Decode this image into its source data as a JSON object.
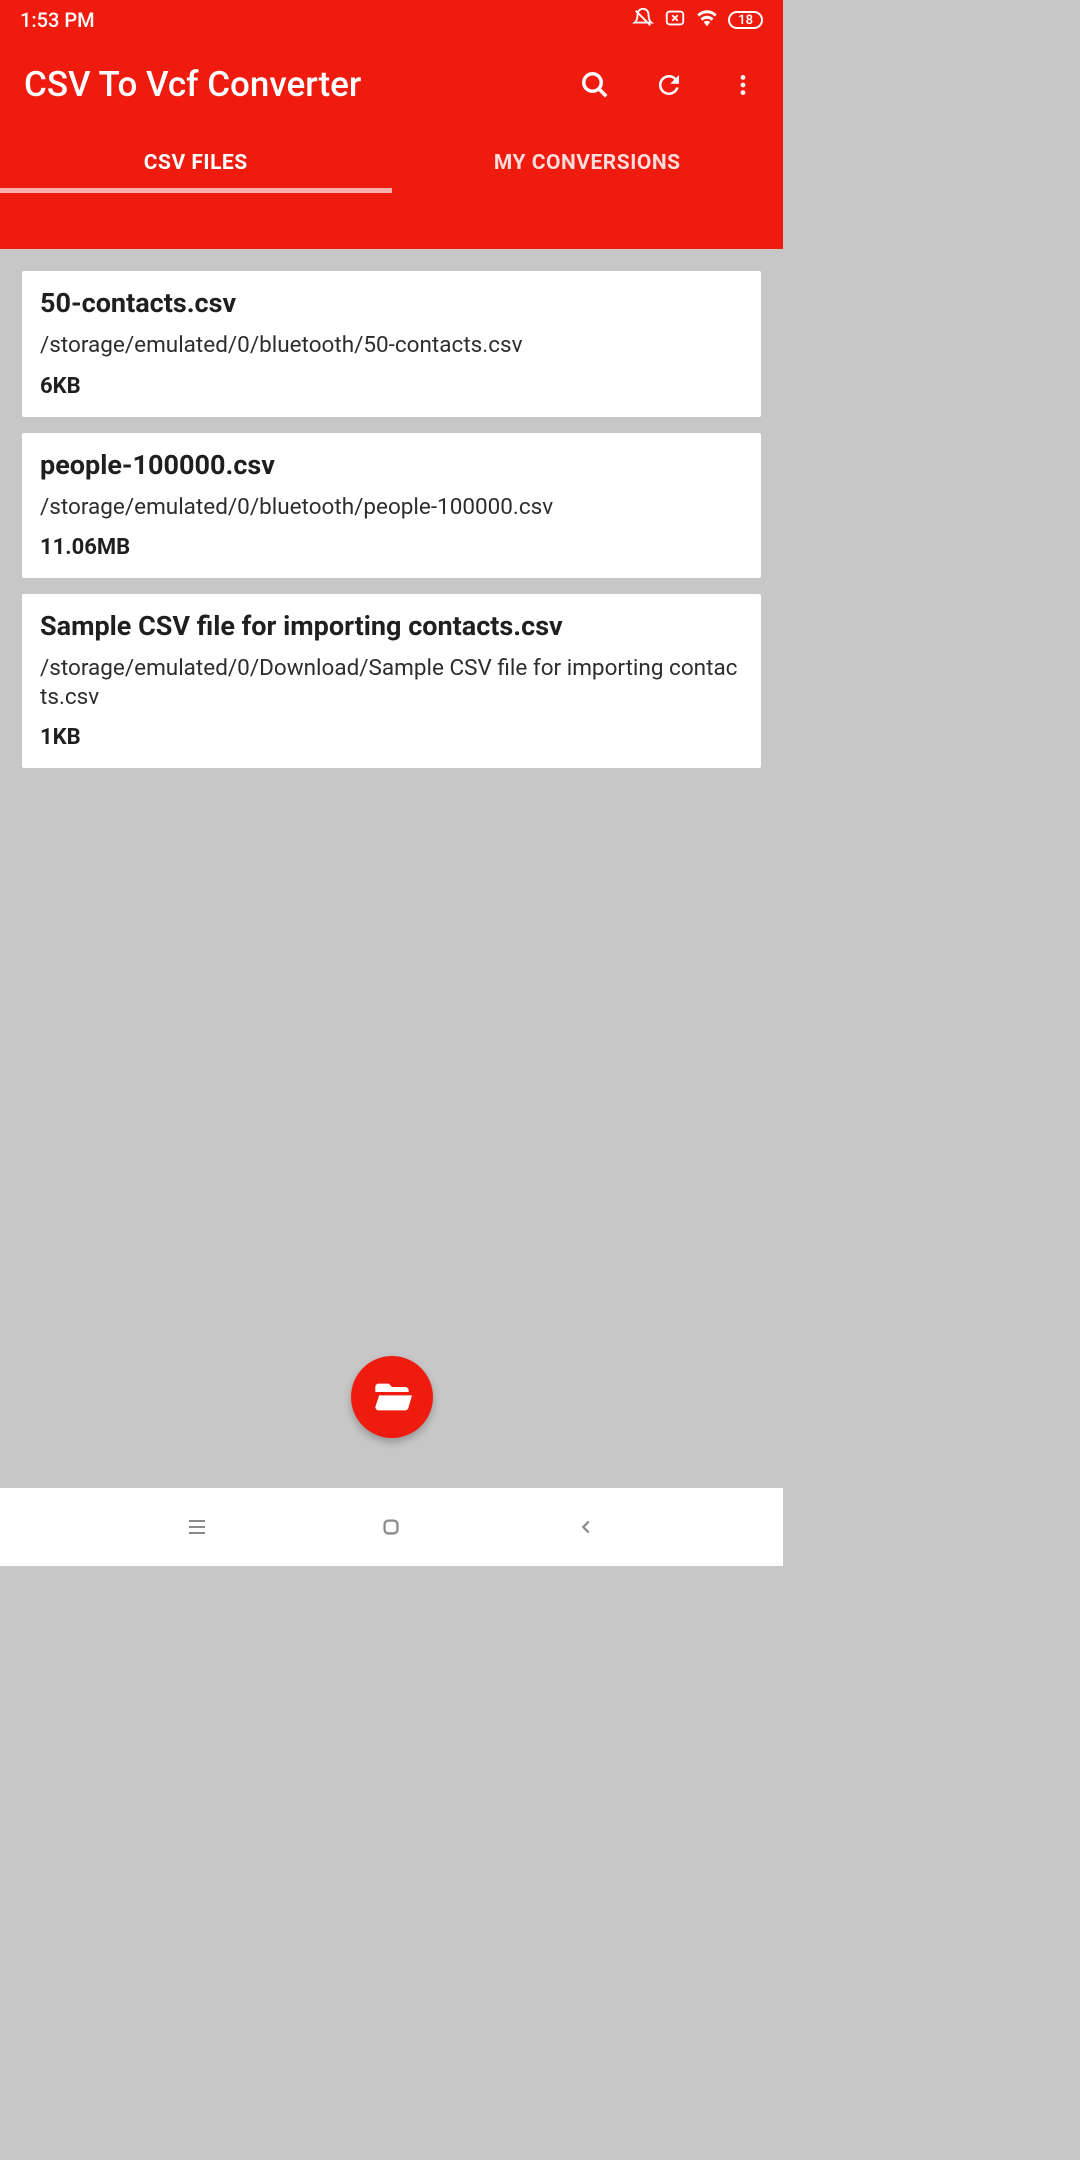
{
  "status": {
    "time": "1:53 PM",
    "battery": "18"
  },
  "app": {
    "title": "CSV To Vcf Converter"
  },
  "tabs": [
    {
      "label": "CSV FILES",
      "active": true
    },
    {
      "label": "MY CONVERSIONS",
      "active": false
    }
  ],
  "files": [
    {
      "name": "50-contacts.csv",
      "path": "/storage/emulated/0/bluetooth/50-contacts.csv",
      "size": "6KB"
    },
    {
      "name": "people-100000.csv",
      "path": "/storage/emulated/0/bluetooth/people-100000.csv",
      "size": "11.06MB"
    },
    {
      "name": "Sample CSV file for importing contacts.csv",
      "path": "/storage/emulated/0/Download/Sample CSV file for importing contacts.csv",
      "size": "1KB"
    }
  ]
}
